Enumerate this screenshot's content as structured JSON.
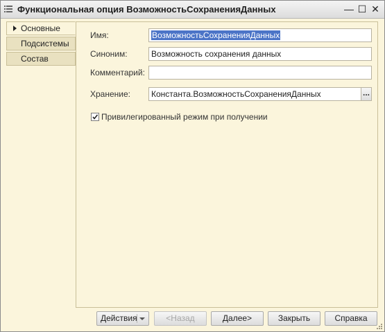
{
  "window": {
    "title": "Функциональная опция ВозможностьСохраненияДанных",
    "minimize_glyph": "—",
    "maximize_glyph": "☐",
    "close_glyph": "✕"
  },
  "tabs": [
    {
      "label": "Основные",
      "active": true
    },
    {
      "label": "Подсистемы",
      "active": false
    },
    {
      "label": "Состав",
      "active": false
    }
  ],
  "form": {
    "name_label": "Имя:",
    "name_value": "ВозможностьСохраненияДанных",
    "synonym_label": "Синоним:",
    "synonym_value": "Возможность сохранения данных",
    "comment_label": "Комментарий:",
    "comment_value": "",
    "storage_label": "Хранение:",
    "storage_value": "Константа.ВозможностьСохраненияДанных",
    "storage_button": "...",
    "privileged_label": "Привилегированный режим при получении",
    "privileged_checked": true
  },
  "buttons": {
    "actions": "Действия",
    "back": "<Назад",
    "next": "Далее>",
    "close": "Закрыть",
    "help": "Справка"
  },
  "icons": {
    "window_icon": "list-icon",
    "active_tab_marker": "triangle-right-icon",
    "check_mark": "check-icon",
    "actions_dropdown": "chevron-down-icon",
    "resize_grip": "resize-grip-icon"
  }
}
